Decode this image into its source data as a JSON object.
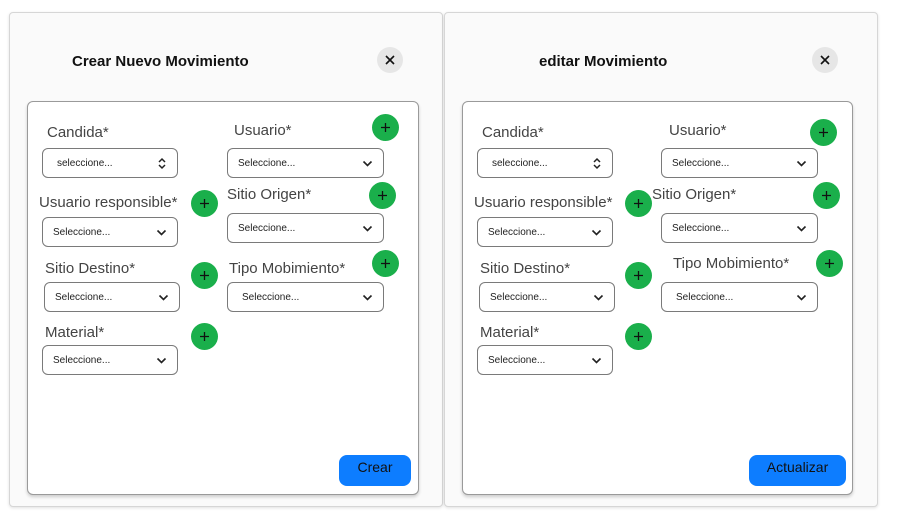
{
  "create_modal": {
    "title": "Crear Nuevo Movimiento",
    "fields": {
      "candida": {
        "label": "Candida*",
        "value": "seleccione..."
      },
      "usuario": {
        "label": "Usuario*",
        "value": "Seleccione..."
      },
      "usuario_responsible": {
        "label": "Usuario responsible*",
        "value": "Seleccione..."
      },
      "sitio_origen": {
        "label": "Sitio Origen*",
        "value": "Seleccione..."
      },
      "sitio_destino": {
        "label": "Sitio Destino*",
        "value": "Seleccione..."
      },
      "tipo_mobimiento": {
        "label": "Tipo Mobimiento*",
        "value": "Seleccione..."
      },
      "material": {
        "label": "Material*",
        "value": "Seleccione..."
      }
    },
    "submit_label": "Crear"
  },
  "edit_modal": {
    "title": "editar Movimiento",
    "fields": {
      "candida": {
        "label": "Candida*",
        "value": "seleccione..."
      },
      "usuario": {
        "label": "Usuario*",
        "value": "Seleccione..."
      },
      "usuario_responsible": {
        "label": "Usuario responsible*",
        "value": "Seleccione..."
      },
      "sitio_origen": {
        "label": "Sitio Origen*",
        "value": "Seleccione..."
      },
      "sitio_destino": {
        "label": "Sitio Destino*",
        "value": "Seleccione..."
      },
      "tipo_mobimiento": {
        "label": "Tipo Mobimiento*",
        "value": "Seleccione..."
      },
      "material": {
        "label": "Material*",
        "value": "Seleccione..."
      }
    },
    "submit_label": "Actualizar"
  },
  "icons": {
    "close": "close-icon",
    "add": "plus-icon",
    "dropdown": "chevron-down-icon",
    "sort": "up-down-chevron-icon"
  },
  "colors": {
    "add_button": "#1aaf4b",
    "primary_button": "#0d7dff",
    "close_button_bg": "#e6e6e6"
  }
}
